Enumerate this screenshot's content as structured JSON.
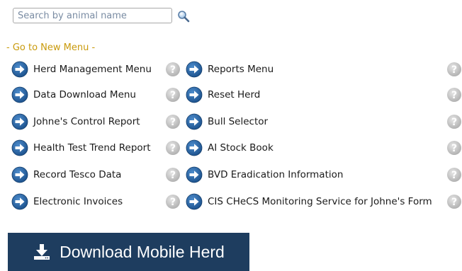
{
  "search": {
    "placeholder": "Search by animal name",
    "value": "",
    "button_icon": "magnifier-icon"
  },
  "menu_heading": "- Go to New Menu -",
  "menu_left": [
    {
      "label": "Herd Management Menu",
      "icon": "arrow-right-circle-icon"
    },
    {
      "label": "Data Download Menu",
      "icon": "arrow-right-circle-icon"
    },
    {
      "label": "Johne's Control Report",
      "icon": "arrow-right-circle-icon"
    },
    {
      "label": "Health Test Trend Report",
      "icon": "arrow-right-circle-icon"
    },
    {
      "label": "Record Tesco Data",
      "icon": "arrow-right-circle-icon"
    },
    {
      "label": "Electronic Invoices",
      "icon": "arrow-right-circle-icon"
    }
  ],
  "menu_right": [
    {
      "label": "Reports Menu",
      "icon": "arrow-right-circle-icon"
    },
    {
      "label": "Reset Herd",
      "icon": "arrow-right-circle-icon"
    },
    {
      "label": "Bull Selector",
      "icon": "arrow-right-circle-icon"
    },
    {
      "label": "AI Stock Book",
      "icon": "arrow-right-circle-icon"
    },
    {
      "label": "BVD Eradication Information",
      "icon": "arrow-right-circle-icon"
    },
    {
      "label": "CIS CHeCS Monitoring Service for Johne's Form",
      "icon": "arrow-right-circle-icon"
    }
  ],
  "help_icon": "help-question-icon",
  "download_button": {
    "label": "Download Mobile Herd",
    "icon": "download-icon"
  },
  "colors": {
    "heading": "#c99a0c",
    "arrow_icon": "#1f5a9a",
    "help_icon": "#bdbdbd",
    "button_bg": "#1e3d5f"
  }
}
